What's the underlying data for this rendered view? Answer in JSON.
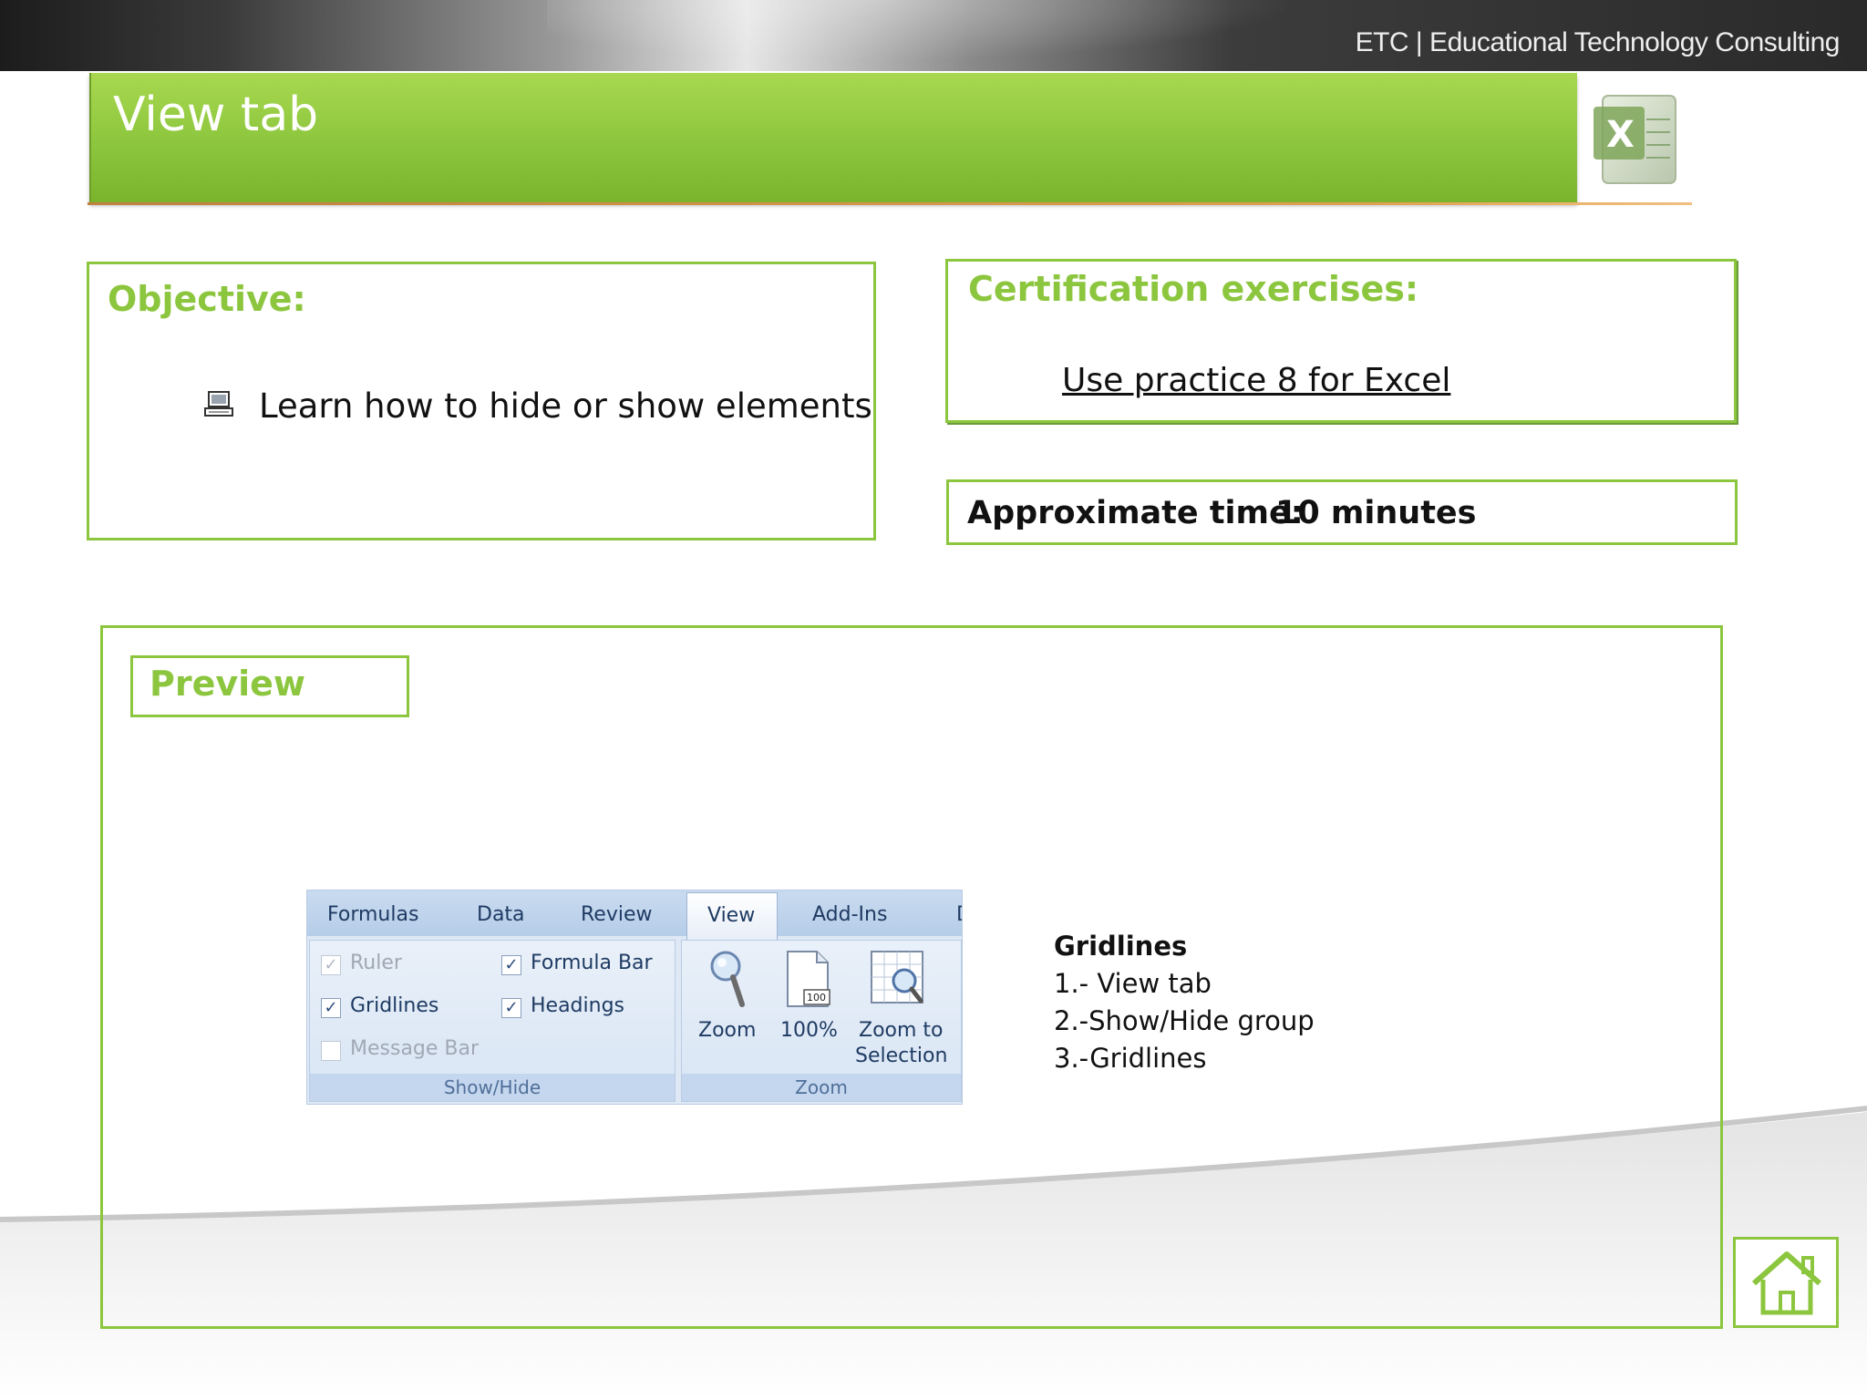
{
  "header": {
    "company": "ETC | Educational Technology Consulting",
    "title": "View tab"
  },
  "objective": {
    "heading": "Objective:",
    "item": "Learn how to hide or show elements",
    "bullet_icon": "laptop-icon"
  },
  "certification": {
    "heading": "Certification exercises:",
    "link": "Use practice 8 for Excel"
  },
  "time": {
    "label": "Approximate time:",
    "value": "10 minutes"
  },
  "preview": {
    "label": "Preview",
    "ribbon": {
      "tabs": [
        "Formulas",
        "Data",
        "Review",
        "View",
        "Add-Ins",
        "D"
      ],
      "active_tab": "View",
      "show_hide": {
        "group_label": "Show/Hide",
        "ruler": "Ruler",
        "formula_bar": "Formula Bar",
        "gridlines": "Gridlines",
        "headings": "Headings",
        "message_bar": "Message Bar",
        "check": "✓"
      },
      "zoom": {
        "group_label": "Zoom",
        "zoom": "Zoom",
        "hundred": "100%",
        "zoom_to_1": "Zoom to",
        "zoom_to_2": "Selection",
        "icon_100_text": "100"
      }
    },
    "notes": {
      "title": "Gridlines",
      "step1": "1.- View tab",
      "step2": "2.-Show/Hide group",
      "step3": "3.-Gridlines"
    }
  },
  "colors": {
    "accent_green": "#8cc63e",
    "banner_green": "#9ccf48",
    "ribbon_blue": "#dfe9f5"
  },
  "home_icon": "home-icon"
}
